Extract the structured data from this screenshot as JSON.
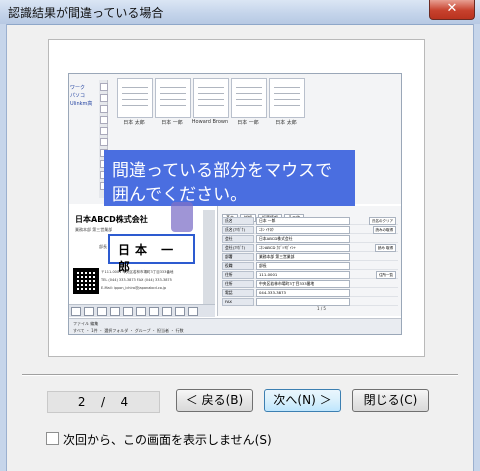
{
  "window": {
    "title": "認識結果が間違っている場合",
    "close_icon": "close-x-icon",
    "close_glyph": "✕"
  },
  "illustration": {
    "callout_line1": "間違っている部分をマウスで",
    "callout_line2": "囲んでください。",
    "callout_color": "#4a6ee0",
    "side_labels": [
      "ワーク",
      "パソコ",
      "Ulinkm高"
    ],
    "thumbnails": [
      {
        "label": "日本 太郎"
      },
      {
        "label": "日本 一郎"
      },
      {
        "label": "Howard Brown"
      },
      {
        "label": "日本 一郎"
      },
      {
        "label": "日本 太郎"
      }
    ],
    "card": {
      "company": "日本ABCD株式会社",
      "department": "業務本部 第三営業部",
      "title": "部長",
      "name": "日本 一郎",
      "address": "〒111-0001 中央区若林市場町3丁目333番地",
      "phone": "TEL (044) 333-3873  FAX (044) 333-3875",
      "email": "E-Mail: ippon_ichiro@japanabcd.co.jp"
    },
    "form_tabs": [
      "基本",
      "詳細",
      "振替情報",
      "その他"
    ],
    "form_rows": [
      {
        "key": "氏名",
        "value": "日本 一郎",
        "button": "氏名のクリア"
      },
      {
        "key": "氏名(ﾌﾘｶﾞﾅ)",
        "value": "ﾆﾎﾝ ｲﾁﾛｳ",
        "button": "読みの取得"
      },
      {
        "key": "会社",
        "value": "日本ABCD株式会社",
        "button": ""
      },
      {
        "key": "会社(ﾌﾘｶﾞﾅ)",
        "value": "ﾆﾎﾝABCD ｶﾌﾞｼｷｶﾞｲｼｬ",
        "button": "読み 取得"
      },
      {
        "key": "部署",
        "value": "業務本部 第三営業部",
        "button": ""
      },
      {
        "key": "役職",
        "value": "部長",
        "button": ""
      },
      {
        "key": "住所",
        "value": "111-0001",
        "button": "住所一覧"
      },
      {
        "key": "住所",
        "value": "中央区若林市場町3丁目333番地",
        "button": ""
      },
      {
        "key": "電話",
        "value": "044-333-3873",
        "button": ""
      },
      {
        "key": "FAX",
        "value": "",
        "button": ""
      }
    ],
    "mini_pager": "1 / 5",
    "bottom_row1": "ファイル   編集",
    "bottom_row2": "すべて ・ 1件 ・ 選択フォルダ ・ グループ ・ 担当者 ・ 行数"
  },
  "pager": {
    "current": "2",
    "separator": "/",
    "total": "4"
  },
  "buttons": {
    "back": "＜ 戻る(B)",
    "next": "次へ(N) ＞",
    "close": "閉じる(C)"
  },
  "footer": {
    "dont_show_label": "次回から、この画面を表示しません(S)",
    "dont_show_checked": false
  }
}
